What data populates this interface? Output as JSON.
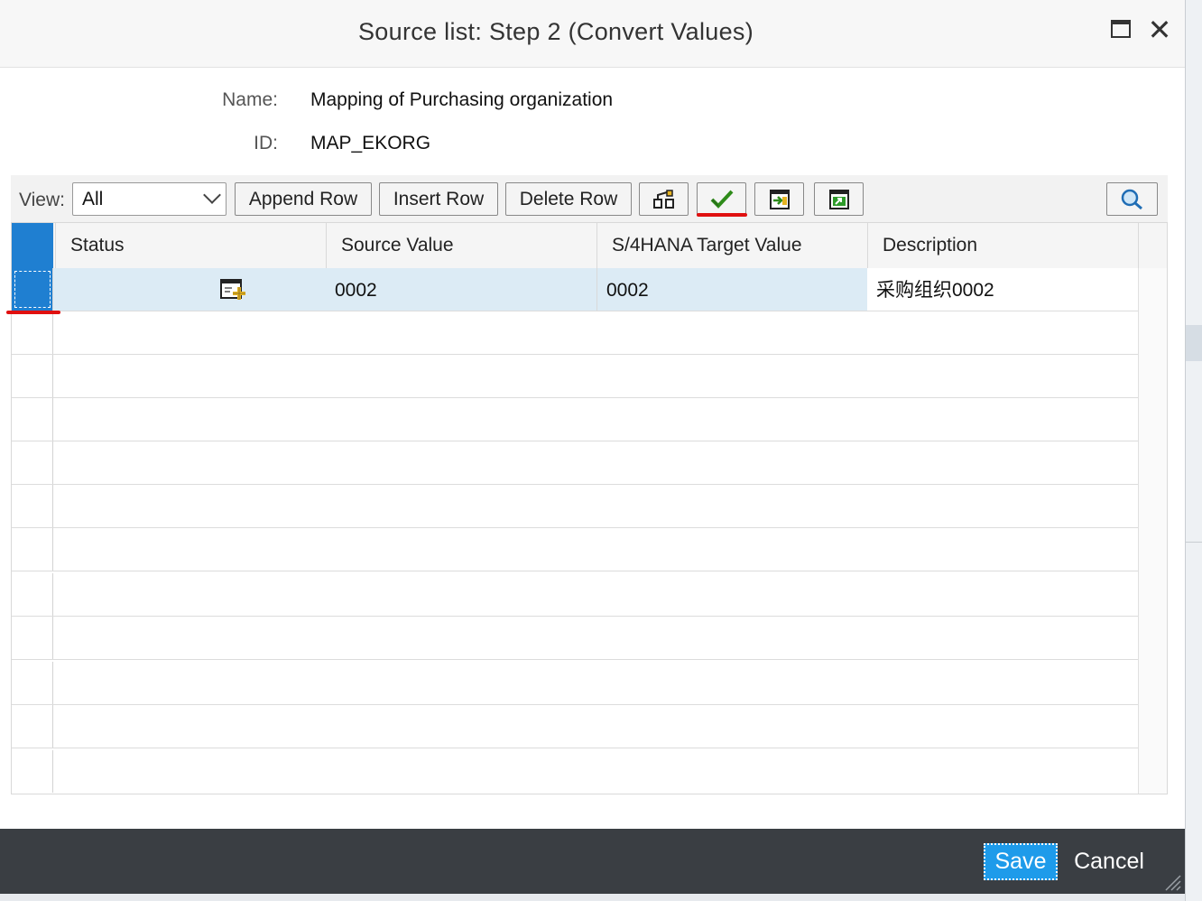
{
  "window": {
    "title": "Source list: Step 2 (Convert Values)",
    "maximize_icon": "maximize-icon",
    "close_icon": "close-icon"
  },
  "fields": {
    "name_label": "Name:",
    "name_value": "Mapping of Purchasing organization",
    "id_label": "ID:",
    "id_value": "MAP_EKORG"
  },
  "toolbar": {
    "view_label": "View:",
    "view_selected": "All",
    "append_row": "Append Row",
    "insert_row": "Insert Row",
    "delete_row": "Delete Row",
    "icons": [
      "hierarchy-icon",
      "check-icon",
      "import-icon",
      "export-icon",
      "search-icon"
    ]
  },
  "table": {
    "columns": [
      "Status",
      "Source Value",
      "S/4HANA Target Value",
      "Description"
    ],
    "rows": [
      {
        "status_icon": "new-entry-icon",
        "source_value": "0002",
        "target_value": "0002",
        "description": "采购组织0002"
      }
    ]
  },
  "footer": {
    "save": "Save",
    "cancel": "Cancel"
  },
  "colors": {
    "accent": "#1f7fd1",
    "save_button": "#1e9bea",
    "footer_bg": "#3a3e43",
    "highlight_mark": "#e01010",
    "selected_row": "#dcebf5"
  }
}
